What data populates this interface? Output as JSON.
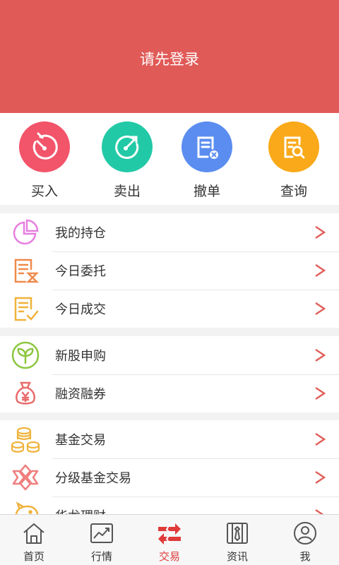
{
  "header": {
    "login_prompt": "请先登录"
  },
  "quick_actions": [
    {
      "label": "买入",
      "icon": "buy-timer-icon",
      "color": "#f2546a"
    },
    {
      "label": "卖出",
      "icon": "sell-target-icon",
      "color": "#22c9a6"
    },
    {
      "label": "撤单",
      "icon": "cancel-order-icon",
      "color": "#5b8df0"
    },
    {
      "label": "查询",
      "icon": "query-search-icon",
      "color": "#f9a919"
    }
  ],
  "groups": [
    {
      "items": [
        {
          "label": "我的持仓",
          "icon": "pie-chart-icon"
        },
        {
          "label": "今日委托",
          "icon": "entrust-list-icon"
        },
        {
          "label": "今日成交",
          "icon": "deal-check-icon"
        }
      ]
    },
    {
      "items": [
        {
          "label": "新股申购",
          "icon": "sprout-icon"
        },
        {
          "label": "融资融券",
          "icon": "money-bag-icon"
        }
      ]
    },
    {
      "items": [
        {
          "label": "基金交易",
          "icon": "coins-icon"
        },
        {
          "label": "分级基金交易",
          "icon": "fund-grade-icon"
        },
        {
          "label": "华龙理财",
          "icon": "piggy-bank-icon"
        }
      ]
    }
  ],
  "tabbar": {
    "items": [
      {
        "label": "首页",
        "icon": "home-icon"
      },
      {
        "label": "行情",
        "icon": "market-chart-icon"
      },
      {
        "label": "交易",
        "icon": "trade-arrows-icon"
      },
      {
        "label": "资讯",
        "icon": "news-tie-icon"
      },
      {
        "label": "我",
        "icon": "profile-icon"
      }
    ],
    "active": "交易"
  },
  "colors": {
    "header": "#e05a57",
    "arrow": "#e0605a",
    "active_tab": "#e03a3a"
  }
}
